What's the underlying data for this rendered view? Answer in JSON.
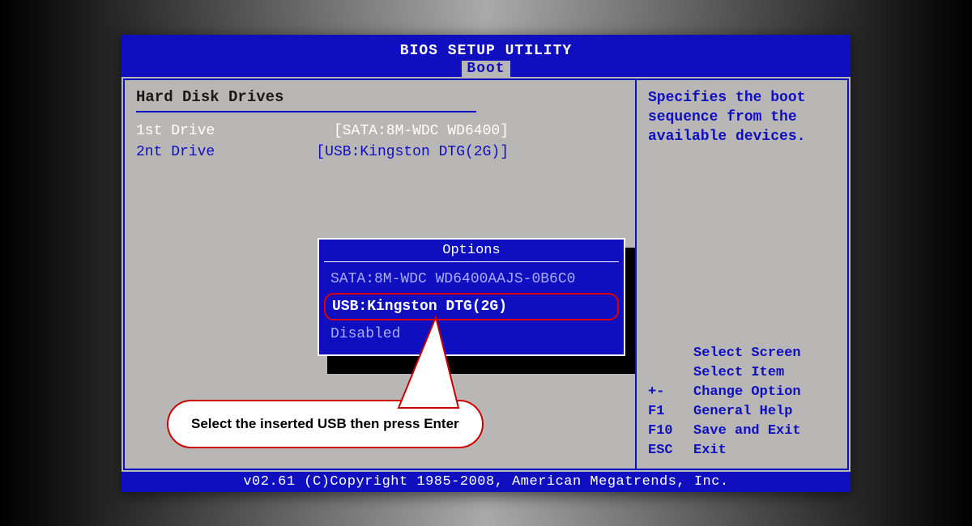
{
  "title": "BIOS SETUP UTILITY",
  "active_tab": "Boot",
  "section_title": "Hard Disk Drives",
  "drives": [
    {
      "label": "1st Drive",
      "value": "[SATA:8M-WDC WD6400]",
      "selected": true
    },
    {
      "label": "2nt Drive",
      "value": "[USB:Kingston DTG(2G)]",
      "selected": false
    }
  ],
  "popup": {
    "title": "Options",
    "items": [
      {
        "text": "SATA:8M-WDC WD6400AAJS-0B6C0",
        "highlight": false
      },
      {
        "text": "USB:Kingston DTG(2G)",
        "highlight": true
      },
      {
        "text": "Disabled",
        "highlight": false
      }
    ]
  },
  "help_text": "Specifies the boot sequence from the available devices.",
  "key_help": [
    {
      "key": "",
      "action": "Select Screen"
    },
    {
      "key": "",
      "action": "Select Item"
    },
    {
      "key": "+-",
      "action": "Change Option"
    },
    {
      "key": "F1",
      "action": "General Help"
    },
    {
      "key": "F10",
      "action": "Save and Exit"
    },
    {
      "key": "ESC",
      "action": "Exit"
    }
  ],
  "footer": "v02.61 (C)Copyright 1985-2008, American Megatrends, Inc.",
  "callout_text": "Select the inserted USB then press Enter"
}
